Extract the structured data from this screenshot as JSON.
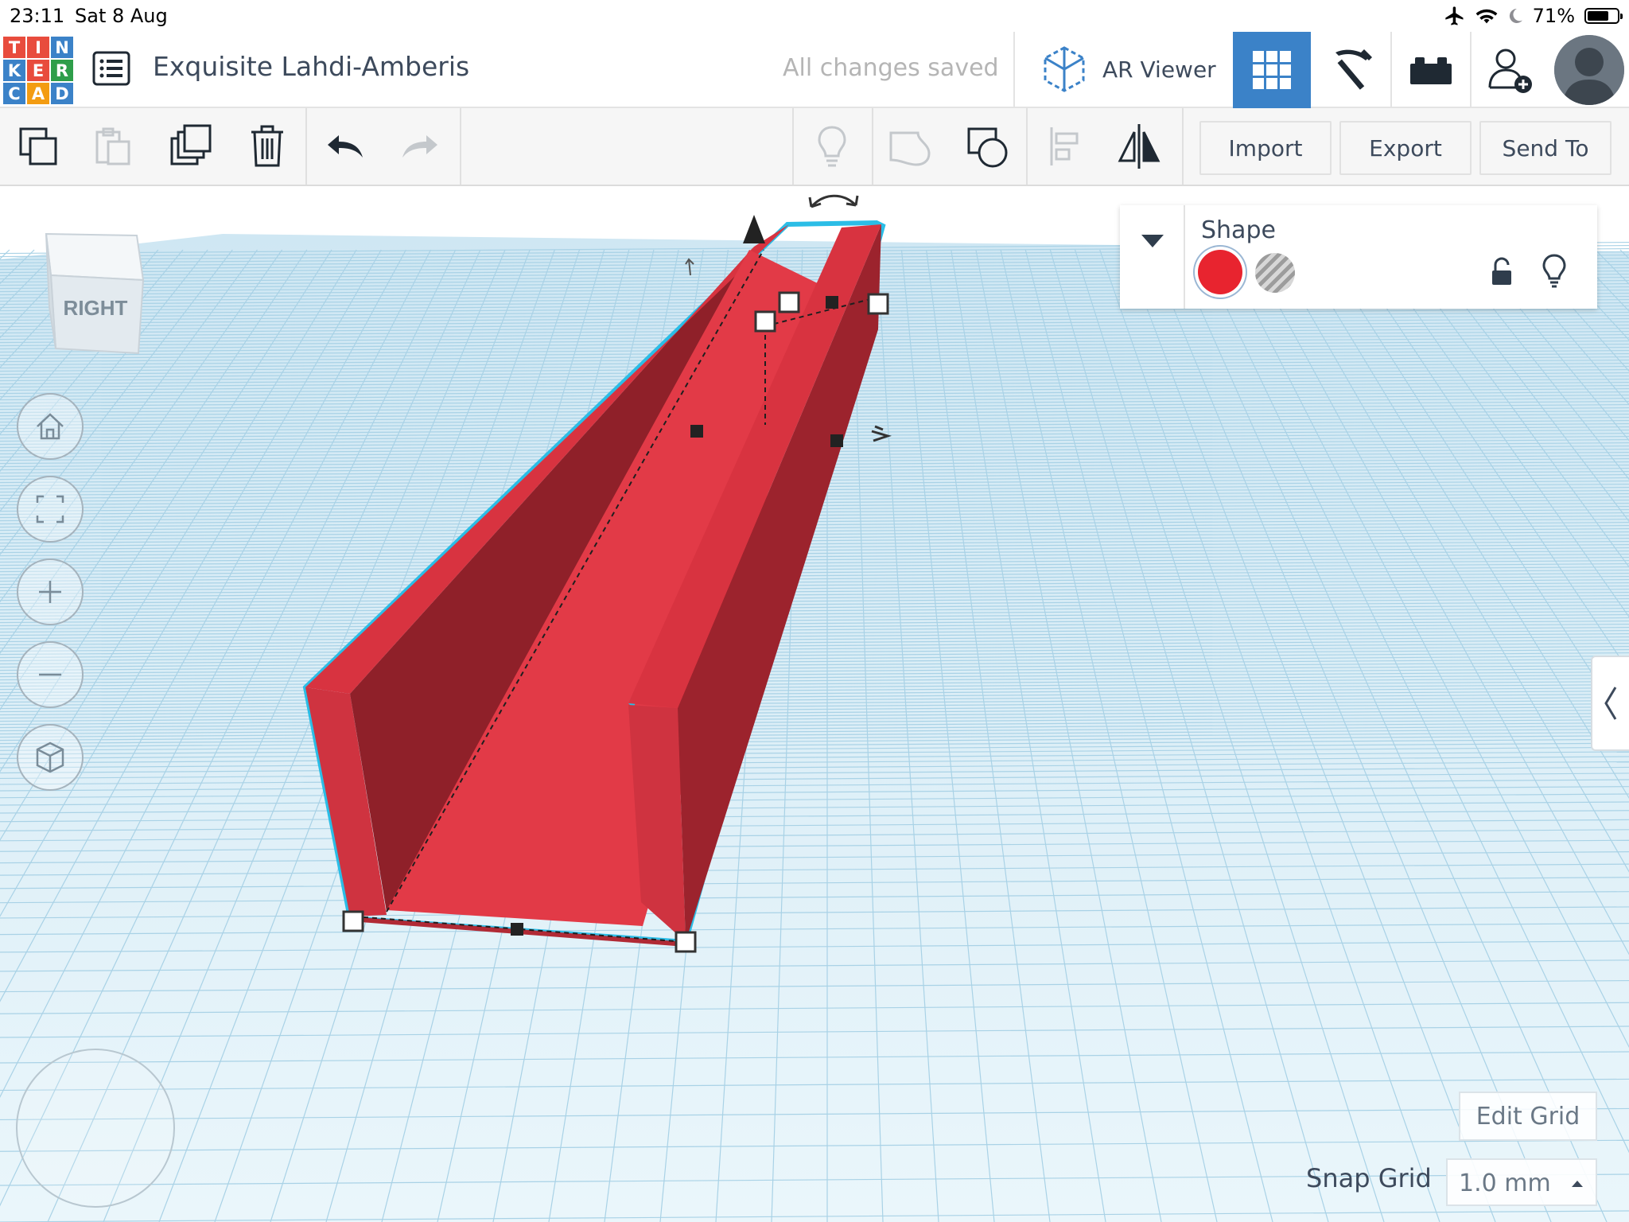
{
  "status_bar": {
    "time": "23:11",
    "date": "Sat 8 Aug",
    "battery": "71%",
    "battery_level": 0.71
  },
  "logo": {
    "letters": [
      "T",
      "I",
      "N",
      "K",
      "E",
      "R",
      "C",
      "A",
      "D"
    ],
    "colors": [
      "#e84c3d",
      "#e84c3d",
      "#3b82c8",
      "#3b82c8",
      "#e84c3d",
      "#2e9e4a",
      "#3b82c8",
      "#f39c12",
      "#3b82c8"
    ]
  },
  "header": {
    "project_title": "Exquisite Lahdi-Amberis",
    "save_status": "All changes saved",
    "ar_viewer_label": "AR Viewer",
    "active_mode": "3d-design",
    "accent_color": "#3b82c8"
  },
  "toolbar": {
    "import_label": "Import",
    "export_label": "Export",
    "send_to_label": "Send To"
  },
  "view_cube": {
    "face_label": "RIGHT"
  },
  "shape_panel": {
    "title": "Shape",
    "solid_color": "#e8242f",
    "selected": "solid"
  },
  "grid_controls": {
    "edit_grid_label": "Edit Grid",
    "snap_grid_label": "Snap Grid",
    "snap_grid_value": "1.0 mm"
  },
  "colors": {
    "workplane": "#e6f3f9",
    "grid_line": "#a9d2e6",
    "object_red": "#d83340",
    "selection_outline": "#2bbde6"
  }
}
